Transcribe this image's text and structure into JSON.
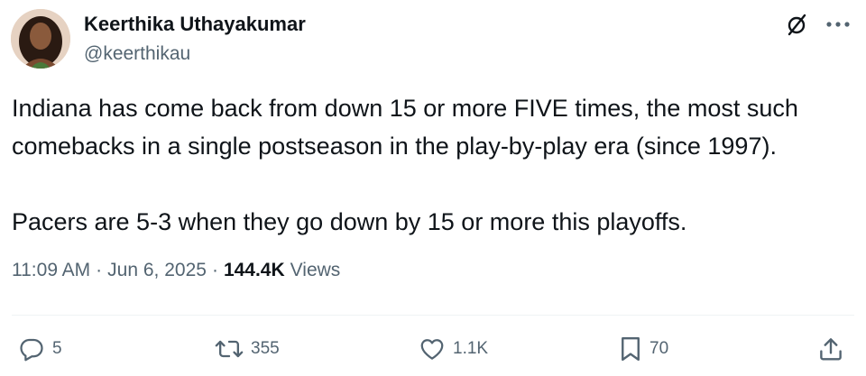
{
  "author": {
    "name": "Keerthika Uthayakumar",
    "handle": "@keerthikau"
  },
  "tweet": {
    "lines": [
      "Indiana has come back from down 15 or more FIVE times, the most such",
      "comebacks in a single postseason in the play-by-play era (since 1997).",
      "Pacers are 5-3 when they go down by 15 or more this playoffs."
    ]
  },
  "meta": {
    "time": "11:09 AM",
    "sep1": "·",
    "date": "Jun 6, 2025",
    "sep2": "·",
    "views_count": "144.4K",
    "views_label": "Views"
  },
  "actions": {
    "replies": "5",
    "reposts": "355",
    "likes": "1.1K",
    "bookmarks": "70"
  },
  "icons": {
    "grok": "grok-icon",
    "more": "more-icon",
    "reply": "reply-icon",
    "repost": "repost-icon",
    "like": "heart-icon",
    "bookmark": "bookmark-icon",
    "share": "share-icon"
  },
  "colors": {
    "text": "#0f1419",
    "secondary": "#536471",
    "divider": "#eff3f4"
  }
}
